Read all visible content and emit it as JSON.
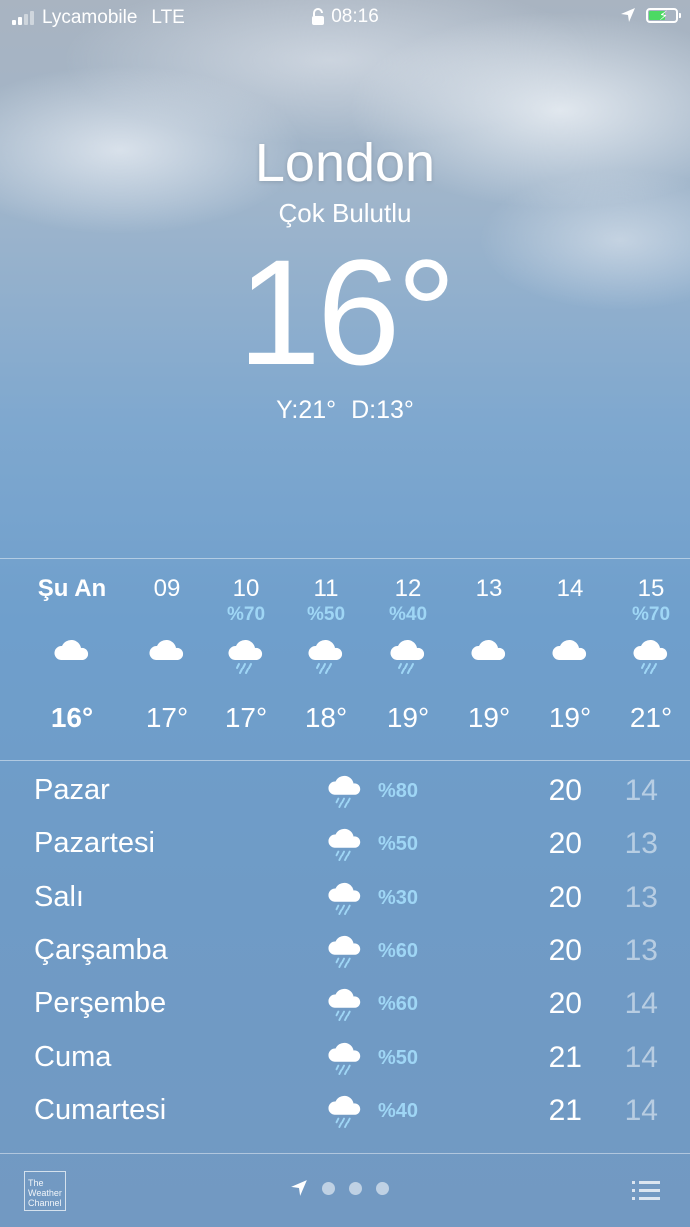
{
  "status_bar": {
    "carrier": "Lycamobile",
    "network": "LTE",
    "time": "08:16",
    "battery_color": "#4cd964"
  },
  "weather": {
    "city": "London",
    "condition": "Çok Bulutlu",
    "temperature": "16°",
    "hilo": "Y:21°  D:13°"
  },
  "hourly": [
    {
      "label": "Şu An",
      "pop": "",
      "icon": "cloud-icon",
      "temp": "16°"
    },
    {
      "label": "09",
      "pop": "",
      "icon": "cloud-icon",
      "temp": "17°"
    },
    {
      "label": "10",
      "pop": "%70",
      "icon": "rain-cloud-icon",
      "temp": "17°"
    },
    {
      "label": "11",
      "pop": "%50",
      "icon": "rain-cloud-icon",
      "temp": "18°"
    },
    {
      "label": "12",
      "pop": "%40",
      "icon": "rain-cloud-icon",
      "temp": "19°"
    },
    {
      "label": "13",
      "pop": "",
      "icon": "cloud-icon",
      "temp": "19°"
    },
    {
      "label": "14",
      "pop": "",
      "icon": "cloud-icon",
      "temp": "19°"
    },
    {
      "label": "15",
      "pop": "%70",
      "icon": "rain-cloud-icon",
      "temp": "21°"
    }
  ],
  "daily": [
    {
      "day": "Pazar",
      "icon": "rain-cloud-icon",
      "pop": "%80",
      "hi": "20",
      "lo": "14"
    },
    {
      "day": "Pazartesi",
      "icon": "rain-cloud-icon",
      "pop": "%50",
      "hi": "20",
      "lo": "13"
    },
    {
      "day": "Salı",
      "icon": "rain-cloud-icon",
      "pop": "%30",
      "hi": "20",
      "lo": "13"
    },
    {
      "day": "Çarşamba",
      "icon": "rain-cloud-icon",
      "pop": "%60",
      "hi": "20",
      "lo": "13"
    },
    {
      "day": "Perşembe",
      "icon": "rain-cloud-icon",
      "pop": "%60",
      "hi": "20",
      "lo": "14"
    },
    {
      "day": "Cuma",
      "icon": "rain-cloud-icon",
      "pop": "%50",
      "hi": "21",
      "lo": "14"
    },
    {
      "day": "Cumartesi",
      "icon": "rain-cloud-icon",
      "pop": "%40",
      "hi": "21",
      "lo": "14"
    }
  ],
  "footer": {
    "logo_line1": "The",
    "logo_line2": "Weather",
    "logo_line3": "Channel",
    "page_count": 3
  }
}
